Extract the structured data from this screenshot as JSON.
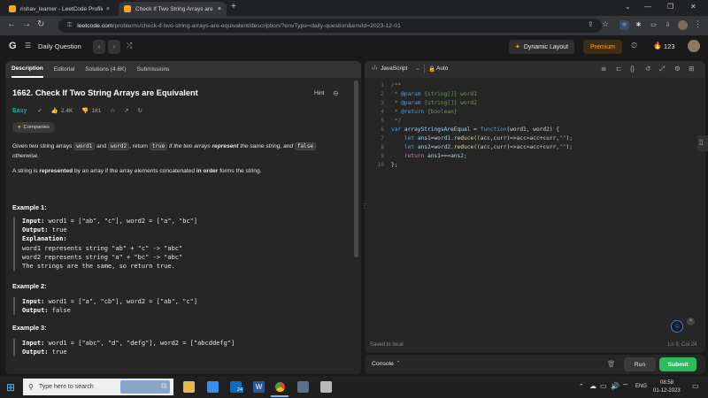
{
  "browser": {
    "tabs": [
      {
        "title": "rishav_learner - LeetCode Profile",
        "close": "×"
      },
      {
        "title": "Check If Two String Arrays are Equ...",
        "close": "×"
      }
    ],
    "new_tab": "+",
    "window_controls": {
      "collapse": "⌄",
      "minimize": "—",
      "maximize": "❐",
      "close": "✕"
    },
    "url_host": "leetcode.com",
    "url_path": "/problems/check-if-two-string-arrays-are-equivalent/description/?envType=daily-question&envId=2023-12-01"
  },
  "lc_nav": {
    "daily_question": "Daily Question",
    "dynamic_layout": "Dynamic Layout",
    "premium": "Premium",
    "streak": "123"
  },
  "problem": {
    "tabs": [
      "Description",
      "Editorial",
      "Solutions (4.6K)",
      "Submissions"
    ],
    "title": "1662. Check If Two String Arrays are Equivalent",
    "hint": "Hint",
    "difficulty": "Easy",
    "likes": "2.4K",
    "dislikes": "181",
    "companies": "Companies",
    "desc1": {
      "a": "Given two string arrays ",
      "c1": "word1",
      "b": " and ",
      "c2": "word2",
      "c": ", return ",
      "c3": "true",
      "d": " if the two arrays ",
      "e": "represent",
      "f": " the same string, and ",
      "c4": "false",
      "g": "otherwise."
    },
    "desc2": {
      "a": "A string is ",
      "b": "represented",
      "c": " by an array if the array elements concatenated ",
      "d": "in order",
      "e": " forms the string."
    },
    "examples": [
      {
        "title": "Example 1:",
        "input_label": "Input:",
        "input": "word1 = [\"ab\", \"c\"], word2 = [\"a\", \"bc\"]",
        "output_label": "Output:",
        "output": "true",
        "explanation_label": "Explanation:",
        "explanation": [
          "word1 represents string \"ab\" + \"c\" -> \"abc\"",
          "word2 represents string \"a\" + \"bc\" -> \"abc\"",
          "The strings are the same, so return true."
        ]
      },
      {
        "title": "Example 2:",
        "input_label": "Input:",
        "input": "word1 = [\"a\", \"cb\"], word2 = [\"ab\", \"c\"]",
        "output_label": "Output:",
        "output": "false"
      },
      {
        "title": "Example 3:",
        "input_label": "Input:",
        "input": "word1  = [\"abc\", \"d\", \"defg\"], word2 = [\"abcddefg\"]",
        "output_label": "Output:",
        "output": "true"
      }
    ]
  },
  "editor": {
    "language": "JavaScript",
    "mode": "Auto",
    "line_numbers": [
      "1",
      "2",
      "3",
      "4",
      "5",
      "6",
      "7",
      "8",
      "9",
      "10"
    ],
    "code": {
      "l1": "/**",
      "l2a": " * ",
      "l2b": "@param",
      "l2c": " {string[]} word1",
      "l3a": " * ",
      "l3b": "@param",
      "l3c": " {string[]} word2",
      "l4a": " * ",
      "l4b": "@return",
      "l4c": " {boolean}",
      "l5": " */",
      "l6a": "var ",
      "l6b": "arrayStringsAreEqual",
      "l6c": " = ",
      "l6d": "function",
      "l6e": "(word1, word2) {",
      "l7a": "    let ",
      "l7b": "ans1",
      "l7c": "=",
      "l7d": "word1",
      "l7e": ".",
      "l7f": "reduce",
      "l7g": "((acc,curr)=>acc=acc+curr,",
      "l7h": "\"\"",
      "l7i": ");",
      "l8a": "    let ",
      "l8b": "ans2",
      "l8c": "=",
      "l8d": "word2",
      "l8e": ".",
      "l8f": "reduce",
      "l8g": "((acc,curr)=>acc=acc+curr,",
      "l8h": "\"\"",
      "l8i": ");",
      "l9a": "    return ",
      "l9b": "ans1",
      "l9c": "===",
      "l9d": "ans2",
      "l9e": ";",
      "l10": "};"
    },
    "saved": "Saved to local",
    "cursor": "Ln 9, Col 24"
  },
  "console": {
    "label": "Console",
    "run": "Run",
    "submit": "Submit"
  },
  "taskbar": {
    "search_placeholder": "Type here to search",
    "lang": "ENG",
    "time": "08:58",
    "date": "01-12-2023",
    "badge": "24"
  }
}
